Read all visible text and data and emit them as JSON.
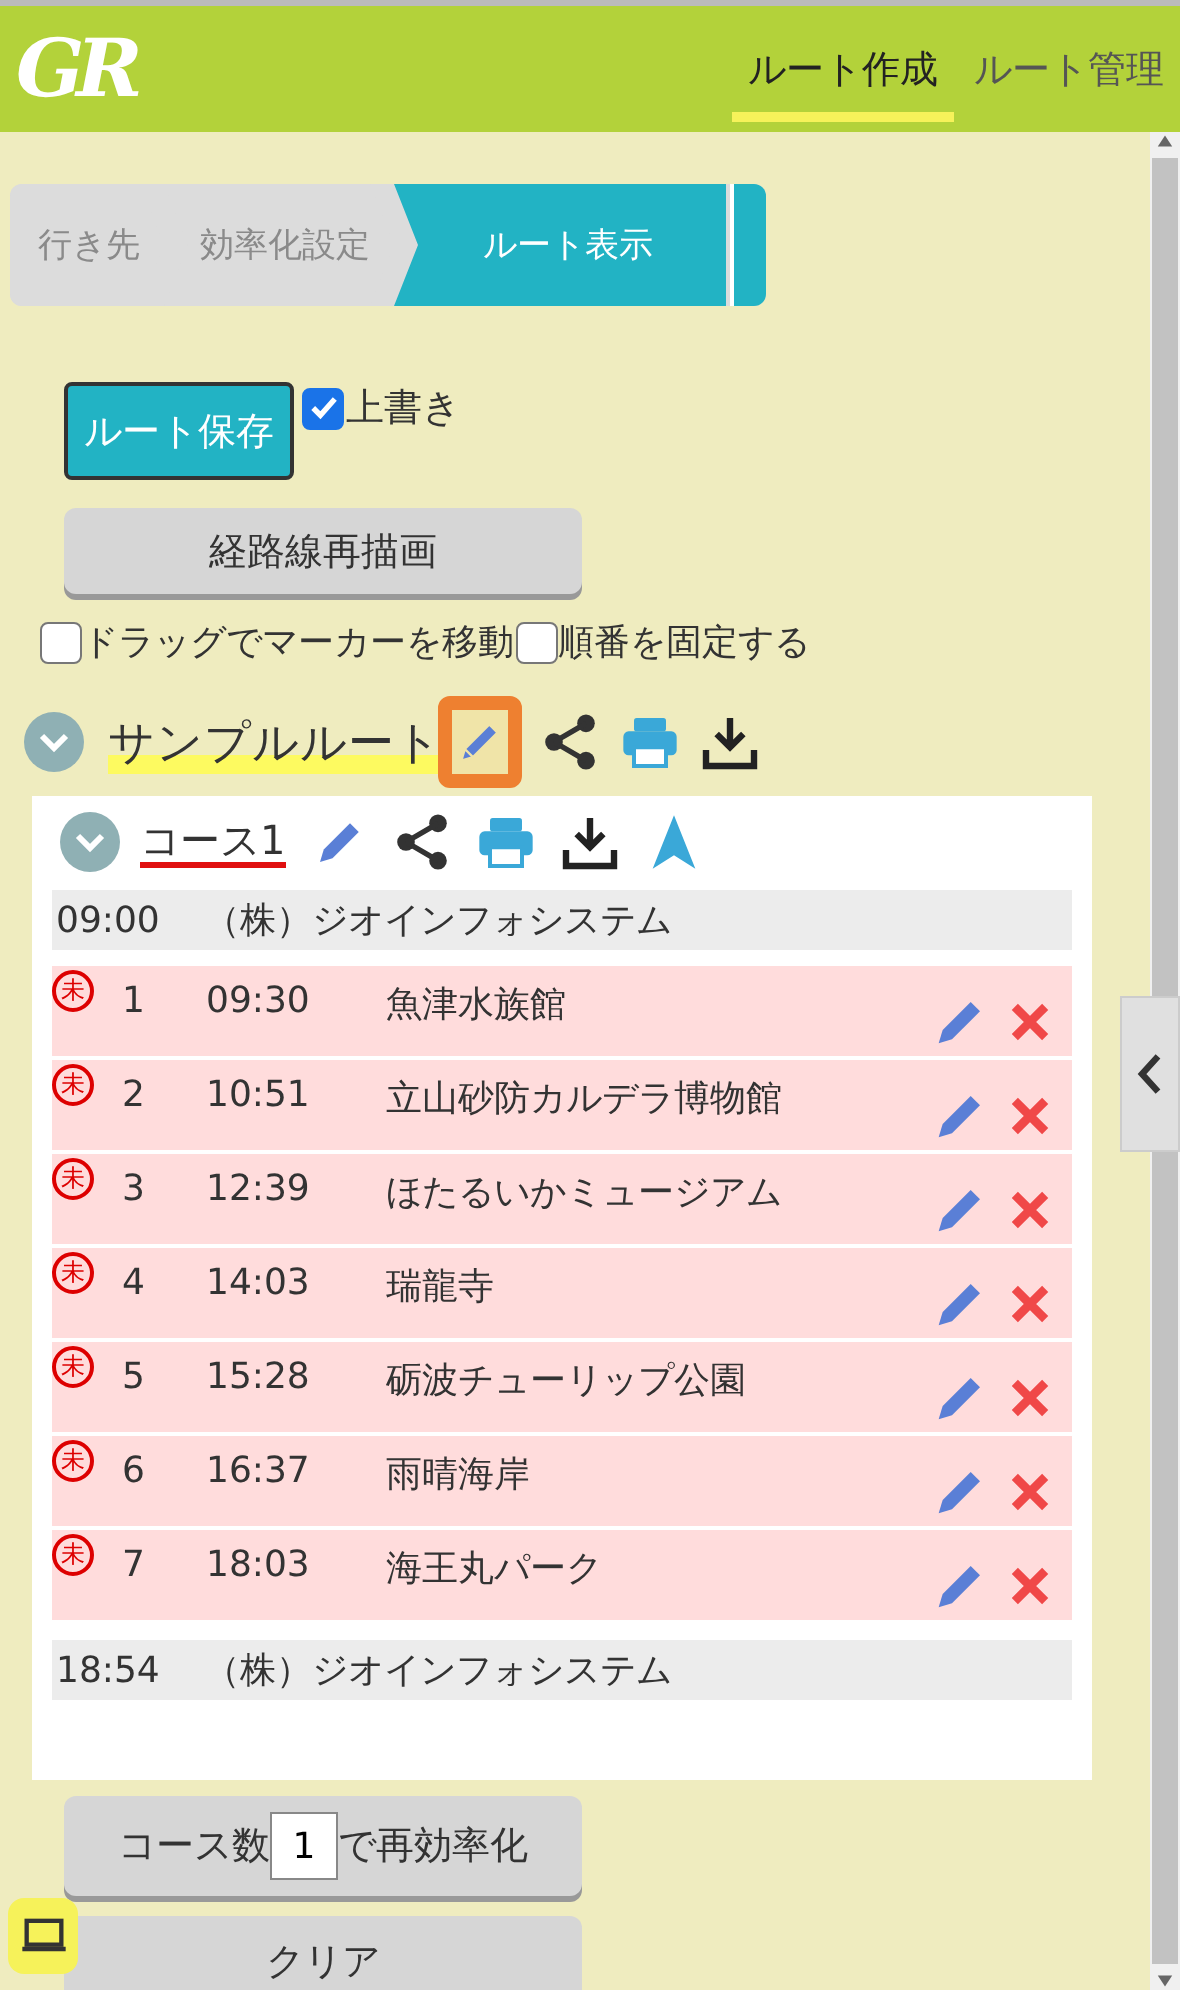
{
  "logo": "GR",
  "nav_tabs": [
    {
      "label": "ルート作成",
      "selected": true
    },
    {
      "label": "ルート管理",
      "selected": false
    }
  ],
  "steps": [
    {
      "label": "行き先",
      "selected": false
    },
    {
      "label": "効率化設定",
      "selected": false
    },
    {
      "label": "ルート表示",
      "selected": true
    }
  ],
  "save_button": "ルート保存",
  "overwrite": {
    "label": "上書き",
    "checked": true
  },
  "redraw_button": "経路線再描画",
  "options": [
    {
      "label": "ドラッグでマーカーを移動",
      "checked": false
    },
    {
      "label": "順番を固定する",
      "checked": false
    }
  ],
  "route": {
    "name": "サンプルルート",
    "expanded": true,
    "edit_highlighted": true
  },
  "course": {
    "name": "コース1",
    "expanded": true,
    "start": {
      "time": "09:00",
      "name": "（株）ジオインフォシステム"
    },
    "stops": [
      {
        "mark": "未",
        "number": "1",
        "time": "09:30",
        "name": "魚津水族館"
      },
      {
        "mark": "未",
        "number": "2",
        "time": "10:51",
        "name": "立山砂防カルデラ博物館"
      },
      {
        "mark": "未",
        "number": "3",
        "time": "12:39",
        "name": "ほたるいかミュージアム"
      },
      {
        "mark": "未",
        "number": "4",
        "time": "14:03",
        "name": "瑞龍寺"
      },
      {
        "mark": "未",
        "number": "5",
        "time": "15:28",
        "name": "砺波チューリップ公園"
      },
      {
        "mark": "未",
        "number": "6",
        "time": "16:37",
        "name": "雨晴海岸"
      },
      {
        "mark": "未",
        "number": "7",
        "time": "18:03",
        "name": "海王丸パーク"
      }
    ],
    "end": {
      "time": "18:54",
      "name": "（株）ジオインフォシステム"
    }
  },
  "reoptimize": {
    "prefix": "コース数",
    "count": "1",
    "suffix": "で再効率化"
  },
  "clear_button": "クリア"
}
